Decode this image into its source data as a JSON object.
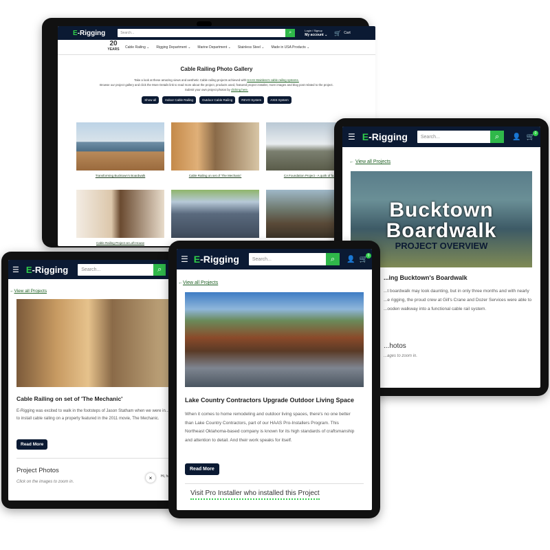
{
  "brand": {
    "logo_e": "E",
    "logo_rest": "-Rigging",
    "accent": "#2fcc4a",
    "navy": "#0b1a33"
  },
  "laptop": {
    "search_placeholder": "Search...",
    "login_label": "Login / Signup",
    "account_label": "My account",
    "cart_count": "0",
    "cart_label": "Cart",
    "badge_number": "20",
    "badge_text": "YEARS",
    "nav": [
      "Cable Railing",
      "Rigging Department",
      "Marine Department",
      "Stainless Steel",
      "Made in USA Products"
    ],
    "title": "Cable Railing Photo Gallery",
    "intro_1a": "Take a look at these amazing views and aesthetic Cable railing projects achieved with ",
    "intro_1_link": "HAAS Stainless's cable railing systems.",
    "intro_2": "Browse our project gallery and click the More Details link to read more about the project, products used, featured project installer, more images and blog post related to the project.",
    "intro_3a": "Submit your own project photos by ",
    "intro_3_link": "clicking here.",
    "filters": [
      "Show all",
      "Indoor Cable Railing",
      "Outdoor Cable Railing",
      "REVO System",
      "AXIS System"
    ],
    "gallery": [
      {
        "caption": "Transforming Bucktown's Boardwalk"
      },
      {
        "caption": "Cable Railing on set of 'The Mechanic'"
      },
      {
        "caption": "CA Foundation Project - A quirk of fa..."
      },
      {
        "caption": "Cable Railing Project at Loft House"
      },
      {
        "caption": "Cable Rail Deck Transformation"
      },
      {
        "caption": "Lakehouse Cable Railing Project"
      }
    ]
  },
  "tablet_right": {
    "search_placeholder": "Search...",
    "cart_count": "0",
    "back_link": "View all Projects",
    "hero_line1": "Bucktown",
    "hero_line2": "Boardwalk",
    "hero_sub": "PROJECT OVERVIEW",
    "heading": "...ing Bucktown's Boardwalk",
    "body_lines": [
      "...t boardwalk may look daunting, but in only three months and with nearly",
      "...e rigging, the proud crew at Gill's Crane and Dozer Services were able to",
      "...ooden walkway into a functional cable rail system."
    ],
    "photos_heading": "...hotos",
    "photos_hint": "...ages to zoom in."
  },
  "tablet_left": {
    "search_placeholder": "Search...",
    "back_link": "View all Projects",
    "heading": "Cable Railing on set of 'The Mechanic'",
    "body_lines": [
      "E-Rigging was excited to walk in the footsteps of Jason Statham when we were in...",
      "to install cable railing on a property featured in the 2011 movie, The Mechanic."
    ],
    "read_more": "Read More",
    "photos_heading": "Project Photos",
    "photos_hint": "Click on the images to zoom in.",
    "chat_close": "×",
    "chat_text": "Hi, ha..."
  },
  "tablet_center": {
    "search_placeholder": "Search...",
    "cart_count": "0",
    "back_link": "View all Projects",
    "heading": "Lake Country Contractors Upgrade Outdoor Living Space",
    "body_lines": [
      "When it comes to home remodeling and outdoor living spaces, there's no one better",
      "than Lake Country Contractors, part of our HAAS Pro-Installers Program. This",
      "Northeast Oklahoma-based company is known for its high standards of craftsmanship",
      "and attention to detail. And their work speaks for itself."
    ],
    "read_more": "Read More",
    "installer_link": "Visit Pro Installer who installed this Project"
  }
}
